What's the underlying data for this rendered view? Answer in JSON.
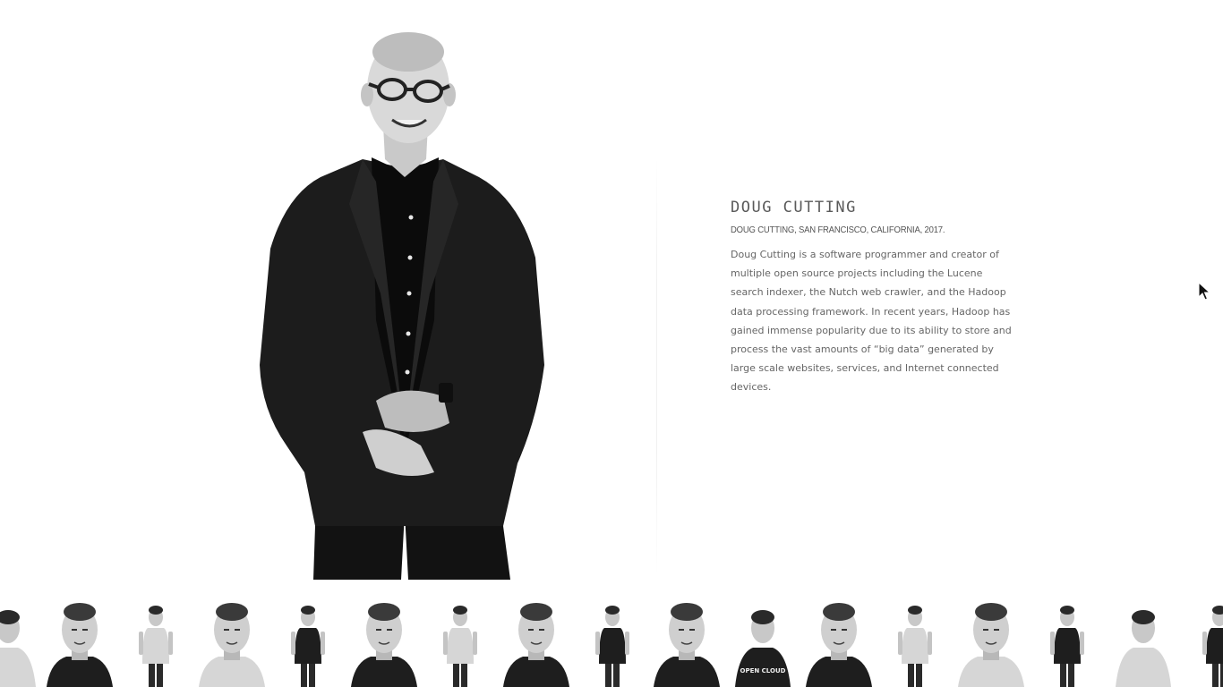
{
  "person": {
    "name": "DOUG CUTTING",
    "caption": "DOUG CUTTING, SAN FRANCISCO, CALIFORNIA, 2017.",
    "bio": "Doug Cutting is a software programmer and creator of multiple open source projects including the Lucene search indexer, the Nutch web crawler, and the Hadoop data processing framework. In recent years, Hadoop has gained immense popularity due to its ability to store and process the vast amounts of “big data” generated by large scale websites, services, and Internet connected devices."
  },
  "thumbnails": {
    "count": 17,
    "shirt_text": "OPEN CLOUD"
  },
  "colors": {
    "background": "#ffffff",
    "heading": "#5a5a5a",
    "body_text": "#666666",
    "portrait_dark": "#141414"
  },
  "icons": {
    "cursor": "mouse-pointer-icon"
  }
}
